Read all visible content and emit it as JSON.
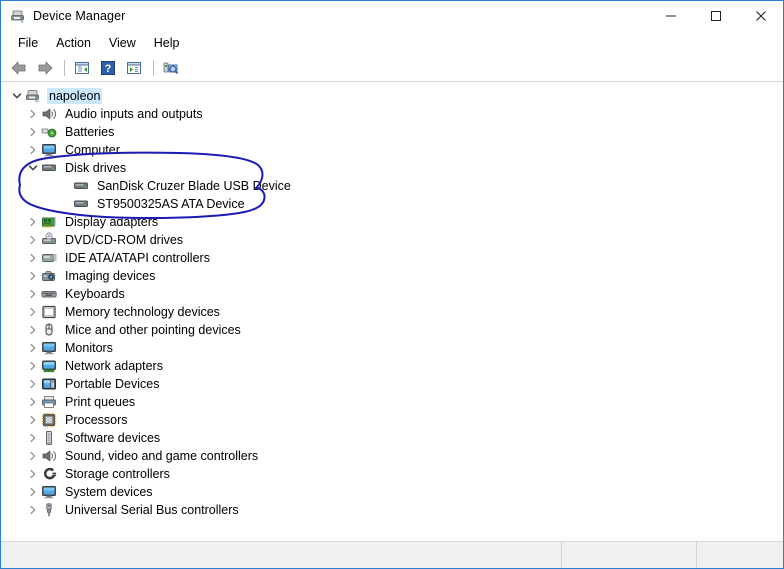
{
  "window": {
    "title": "Device Manager",
    "title_icon": "device-manager-icon",
    "border_color": "#2a7fd4",
    "caption_buttons": [
      {
        "name": "minimize",
        "glyph": "—"
      },
      {
        "name": "maximize",
        "glyph": "☐"
      },
      {
        "name": "close",
        "glyph": "✕"
      }
    ]
  },
  "menubar": {
    "items": [
      {
        "label": "File"
      },
      {
        "label": "Action"
      },
      {
        "label": "View"
      },
      {
        "label": "Help"
      }
    ]
  },
  "toolbar": {
    "buttons": [
      {
        "name": "back-arrow-icon",
        "tip": "Back"
      },
      {
        "name": "forward-arrow-icon",
        "tip": "Forward"
      },
      {
        "name": "separator-1"
      },
      {
        "name": "show-hide-console-tree-icon",
        "tip": "Show/Hide Console Tree"
      },
      {
        "name": "help-icon",
        "tip": "Help"
      },
      {
        "name": "properties-icon",
        "tip": "Properties"
      },
      {
        "name": "separator-2"
      },
      {
        "name": "scan-hardware-changes-icon",
        "tip": "Scan for hardware changes"
      }
    ]
  },
  "tree": {
    "selected_item": "napoleon",
    "selection_color": "#cce8ff",
    "items": [
      {
        "label": "napoleon",
        "depth": 0,
        "state": "expanded",
        "icon": "computer-root-icon"
      },
      {
        "label": "Audio inputs and outputs",
        "depth": 1,
        "state": "collapsed",
        "icon": "speaker-icon"
      },
      {
        "label": "Batteries",
        "depth": 1,
        "state": "collapsed",
        "icon": "battery-icon"
      },
      {
        "label": "Computer",
        "depth": 1,
        "state": "collapsed",
        "icon": "computer-icon"
      },
      {
        "label": "Disk drives",
        "depth": 1,
        "state": "expanded",
        "icon": "disk-drive-icon"
      },
      {
        "label": "SanDisk Cruzer Blade USB Device",
        "depth": 2,
        "state": "leaf",
        "icon": "disk-drive-icon"
      },
      {
        "label": "ST9500325AS ATA Device",
        "depth": 2,
        "state": "leaf",
        "icon": "disk-drive-icon"
      },
      {
        "label": "Display adapters",
        "depth": 1,
        "state": "collapsed",
        "icon": "display-adapter-icon"
      },
      {
        "label": "DVD/CD-ROM drives",
        "depth": 1,
        "state": "collapsed",
        "icon": "optical-drive-icon"
      },
      {
        "label": "IDE ATA/ATAPI controllers",
        "depth": 1,
        "state": "collapsed",
        "icon": "ide-controller-icon"
      },
      {
        "label": "Imaging devices",
        "depth": 1,
        "state": "collapsed",
        "icon": "camera-icon"
      },
      {
        "label": "Keyboards",
        "depth": 1,
        "state": "collapsed",
        "icon": "keyboard-icon"
      },
      {
        "label": "Memory technology devices",
        "depth": 1,
        "state": "collapsed",
        "icon": "memory-icon"
      },
      {
        "label": "Mice and other pointing devices",
        "depth": 1,
        "state": "collapsed",
        "icon": "mouse-icon"
      },
      {
        "label": "Monitors",
        "depth": 1,
        "state": "collapsed",
        "icon": "monitor-icon"
      },
      {
        "label": "Network adapters",
        "depth": 1,
        "state": "collapsed",
        "icon": "network-adapter-icon"
      },
      {
        "label": "Portable Devices",
        "depth": 1,
        "state": "collapsed",
        "icon": "portable-device-icon"
      },
      {
        "label": "Print queues",
        "depth": 1,
        "state": "collapsed",
        "icon": "printer-icon"
      },
      {
        "label": "Processors",
        "depth": 1,
        "state": "collapsed",
        "icon": "processor-icon"
      },
      {
        "label": "Software devices",
        "depth": 1,
        "state": "collapsed",
        "icon": "software-device-icon"
      },
      {
        "label": "Sound, video and game controllers",
        "depth": 1,
        "state": "collapsed",
        "icon": "speaker-icon"
      },
      {
        "label": "Storage controllers",
        "depth": 1,
        "state": "collapsed",
        "icon": "storage-controller-icon"
      },
      {
        "label": "System devices",
        "depth": 1,
        "state": "collapsed",
        "icon": "system-device-icon"
      },
      {
        "label": "Universal Serial Bus controllers",
        "depth": 1,
        "state": "collapsed",
        "icon": "usb-controller-icon"
      }
    ]
  },
  "annotation": {
    "name": "hand-drawn-circle",
    "color": "#1a1ab4",
    "stroke_width": 2,
    "encircles": [
      "Disk drives",
      "SanDisk Cruzer Blade USB Device",
      "ST9500325AS ATA Device"
    ]
  },
  "statusbar": {
    "panes": [
      "",
      "",
      ""
    ]
  }
}
